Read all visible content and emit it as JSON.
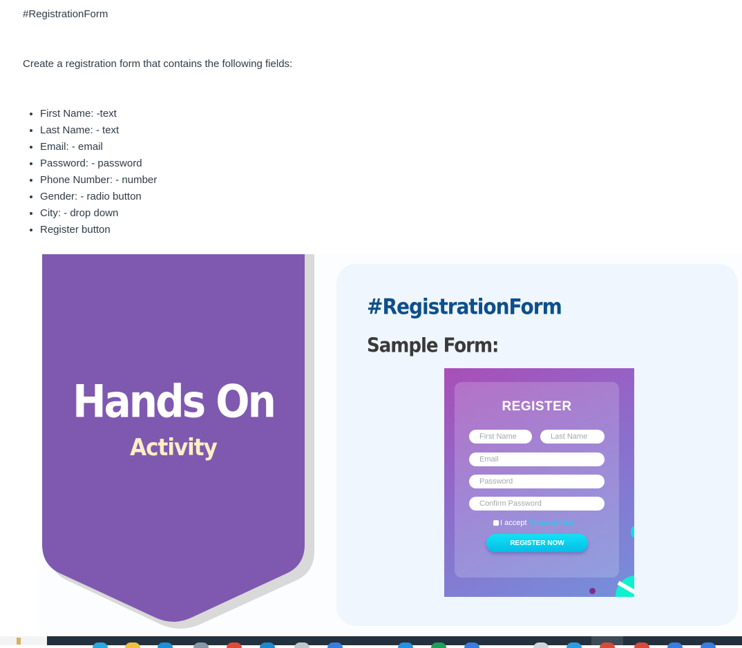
{
  "page": {
    "hashtag": "#RegistrationForm",
    "intro": "Create a registration form that contains the following fields:",
    "requirements": [
      "First Name: -text",
      "Last Name: - text",
      "Email: - email",
      "Password: - password",
      "Phone Number: - number",
      "Gender:  - radio button",
      "City: - drop down",
      "Register button"
    ]
  },
  "graphic": {
    "banner_title": "Hands On",
    "banner_subtitle": "Activity",
    "card_heading": "#RegistrationForm",
    "card_subheading": "Sample Form:",
    "colors": {
      "banner": "#7f59b0",
      "banner_shadow": "#d9d9d9",
      "subtitle": "#ffefc4",
      "heading": "#0d4f8b",
      "card": "#eff6fd"
    },
    "sample_form": {
      "title": "REGISTER",
      "first_name_placeholder": "First Name",
      "last_name_placeholder": "Last Name",
      "email_placeholder": "Email",
      "password_placeholder": "Password",
      "confirm_password_placeholder": "Confirm Password",
      "accept_text": "I accept",
      "terms_link": "Terms of Use",
      "button_label": "REGISTER NOW"
    }
  },
  "taskbar": {
    "icons": [
      "browser-icon",
      "files-icon",
      "edge-icon",
      "app-icon",
      "chrome-icon",
      "store-icon",
      "mail-icon",
      "chrome-icon",
      "calendar-icon",
      "excel-icon",
      "chrome-icon",
      "notes-icon",
      "vscode-icon",
      "chrome-icon",
      "chrome-icon",
      "chrome-icon",
      "chrome-icon"
    ]
  }
}
